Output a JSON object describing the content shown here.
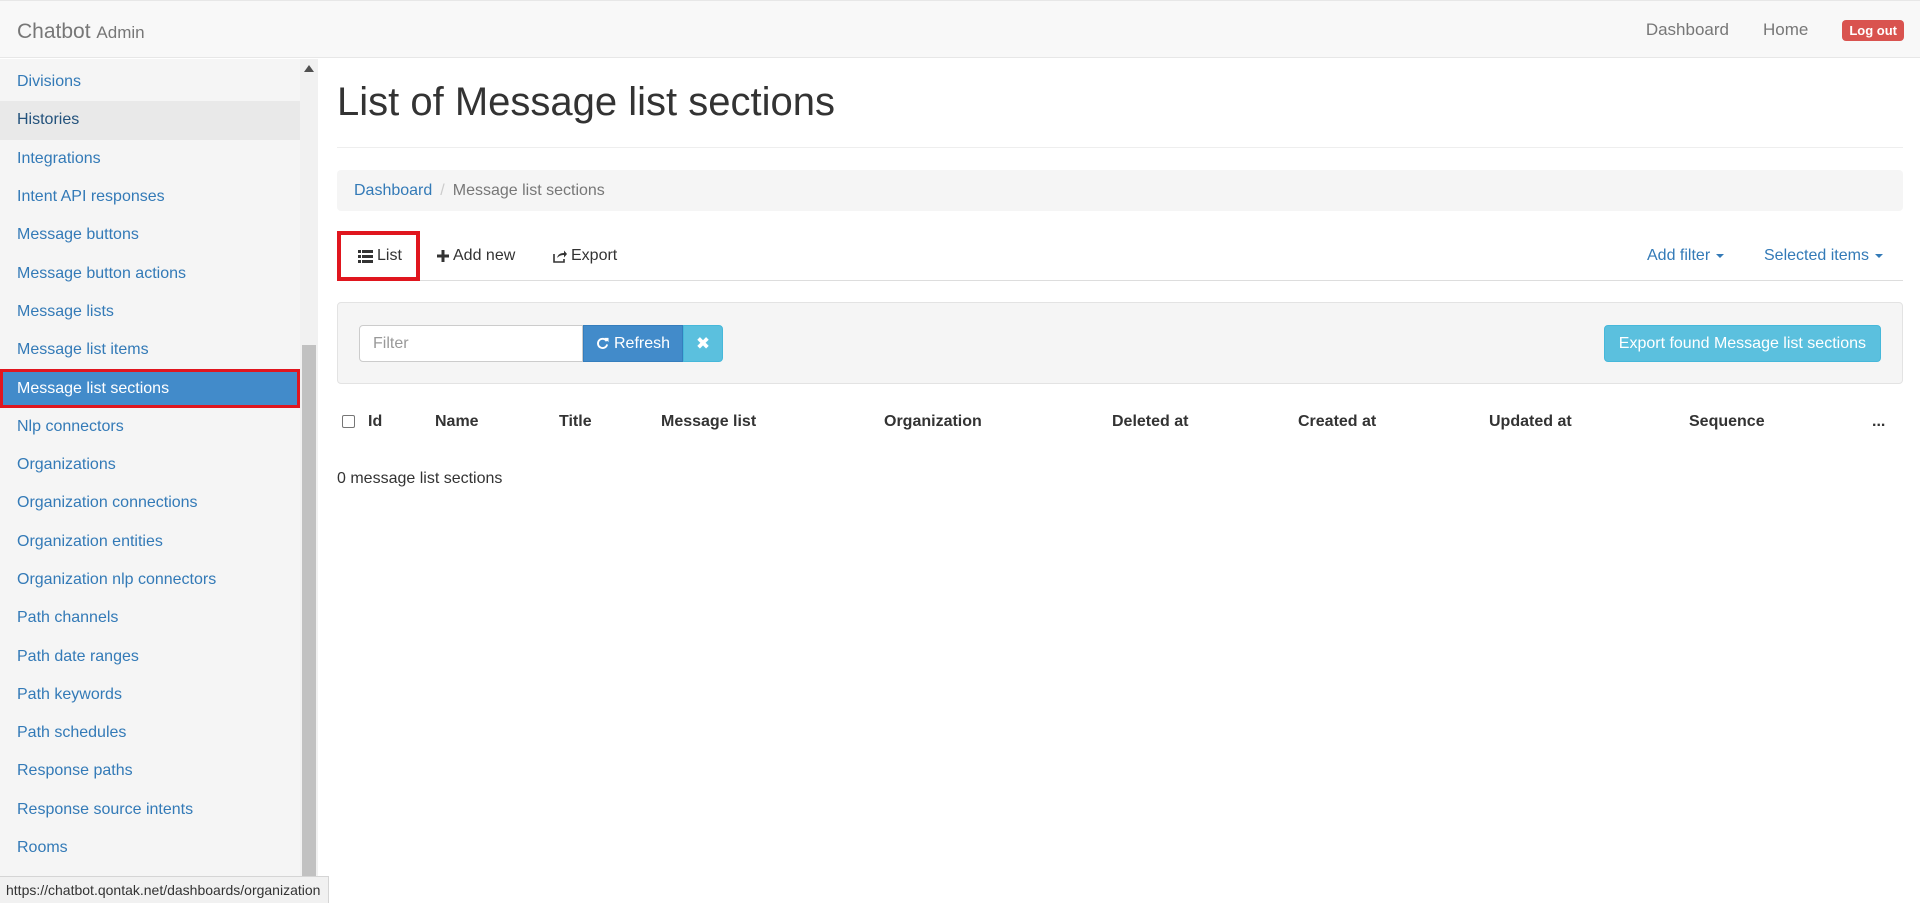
{
  "navbar": {
    "brand": "Chatbot",
    "brand_sub": "Admin",
    "links": [
      "Dashboard",
      "Home"
    ],
    "logout_label": "Log out"
  },
  "sidebar": {
    "items": [
      {
        "label": "Divisions",
        "state": "normal"
      },
      {
        "label": "Histories",
        "state": "hover"
      },
      {
        "label": "Integrations",
        "state": "normal"
      },
      {
        "label": "Intent API responses",
        "state": "normal"
      },
      {
        "label": "Message buttons",
        "state": "normal"
      },
      {
        "label": "Message button actions",
        "state": "normal"
      },
      {
        "label": "Message lists",
        "state": "normal"
      },
      {
        "label": "Message list items",
        "state": "normal"
      },
      {
        "label": "Message list sections",
        "state": "active"
      },
      {
        "label": "Nlp connectors",
        "state": "normal"
      },
      {
        "label": "Organizations",
        "state": "normal"
      },
      {
        "label": "Organization connections",
        "state": "normal"
      },
      {
        "label": "Organization entities",
        "state": "normal"
      },
      {
        "label": "Organization nlp connectors",
        "state": "normal"
      },
      {
        "label": "Path channels",
        "state": "normal"
      },
      {
        "label": "Path date ranges",
        "state": "normal"
      },
      {
        "label": "Path keywords",
        "state": "normal"
      },
      {
        "label": "Path schedules",
        "state": "normal"
      },
      {
        "label": "Response paths",
        "state": "normal"
      },
      {
        "label": "Response source intents",
        "state": "normal"
      },
      {
        "label": "Rooms",
        "state": "normal"
      }
    ]
  },
  "main": {
    "title": "List of Message list sections",
    "breadcrumb": {
      "link": "Dashboard",
      "separator": "/",
      "current": "Message list sections"
    },
    "tabs": {
      "list": "List",
      "add_new": "Add new",
      "export": "Export",
      "add_filter": "Add filter",
      "selected_items": "Selected items"
    },
    "filter": {
      "placeholder": "Filter",
      "value": "",
      "refresh_label": "Refresh",
      "export_found_label": "Export found Message list sections"
    },
    "table": {
      "columns": [
        "Id",
        "Name",
        "Title",
        "Message list",
        "Organization",
        "Deleted at",
        "Created at",
        "Updated at",
        "Sequence",
        "..."
      ],
      "rows": []
    },
    "count_text": "0 message list sections"
  },
  "statusbar": {
    "url": "https://chatbot.qontak.net/dashboards/organization"
  },
  "colors": {
    "link": "#337ab7",
    "active": "#428bca",
    "info": "#5bc0de",
    "danger": "#d9534f",
    "highlight": "#e0161e"
  }
}
